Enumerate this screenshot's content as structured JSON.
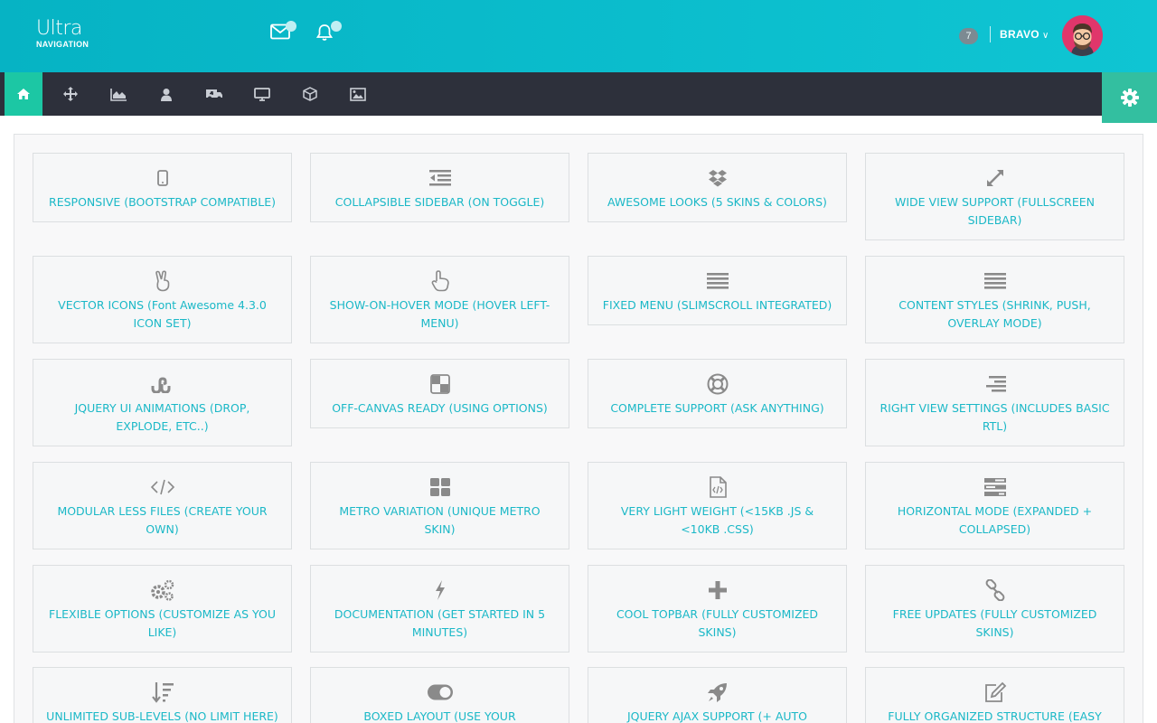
{
  "header": {
    "logo_title": "Ultra",
    "logo_subtitle": "NAVIGATION",
    "icons": [
      "envelope-icon",
      "bell-icon"
    ],
    "badge_count": "7",
    "username": "BRAVO",
    "username_chevron": "∨"
  },
  "nav": {
    "items": [
      "home-icon",
      "arrows-icon",
      "area-chart-icon",
      "user-icon",
      "ambulance-icon",
      "desktop-icon",
      "cube-icon",
      "image-icon"
    ],
    "active_index": 0,
    "settings_icon": "gear-icon"
  },
  "colors": {
    "header": "#0fbfcf",
    "navbar": "#2d303b",
    "active": "#1cc7a4",
    "card_text": "#1bb8c7",
    "icon": "#8a8a8a"
  },
  "features": [
    {
      "icon": "mobile-icon",
      "label": "RESPONSIVE (BOOTSTRAP COMPATIBLE)"
    },
    {
      "icon": "outdent-icon",
      "label": "COLLAPSIBLE SIDEBAR (ON TOGGLE)"
    },
    {
      "icon": "dropbox-icon",
      "label": "AWESOME LOOKS (5 SKINS & COLORS)"
    },
    {
      "icon": "expand-icon",
      "label": "WIDE VIEW SUPPORT (FULLSCREEN SIDEBAR)"
    },
    {
      "icon": "hand-peace-icon",
      "label": "VECTOR ICONS (Font Awesome 4.3.0 ICON SET)"
    },
    {
      "icon": "hand-pointer-icon",
      "label": "SHOW-ON-HOVER MODE (HOVER LEFT-MENU)"
    },
    {
      "icon": "bars-icon",
      "label": "FIXED MENU (SLIMSCROLL INTEGRATED)"
    },
    {
      "icon": "bars-icon",
      "label": "CONTENT STYLES (SHRINK, PUSH, OVERLAY MODE)"
    },
    {
      "icon": "stumbleupon-icon",
      "label": "JQUERY UI ANIMATIONS (DROP, EXPLODE, ETC..)"
    },
    {
      "icon": "delicious-icon",
      "label": "OFF-CANVAS READY (USING OPTIONS)"
    },
    {
      "icon": "life-ring-icon",
      "label": "COMPLETE SUPPORT (ASK ANYTHING)"
    },
    {
      "icon": "align-right-icon",
      "label": "RIGHT VIEW SETTINGS (INCLUDES BASIC RTL)"
    },
    {
      "icon": "code-icon",
      "label": "MODULAR LESS FILES (CREATE YOUR OWN)"
    },
    {
      "icon": "th-large-icon",
      "label": "METRO VARIATION (UNIQUE METRO SKIN)"
    },
    {
      "icon": "file-code-icon",
      "label": "VERY LIGHT WEIGHT (<15KB .JS & <10KB .CSS)"
    },
    {
      "icon": "tasks-icon",
      "label": "HORIZONTAL MODE (EXPANDED + COLLAPSED)"
    },
    {
      "icon": "cogs-icon",
      "label": "FLEXIBLE OPTIONS (CUSTOMIZE AS YOU LIKE)"
    },
    {
      "icon": "bolt-icon",
      "label": "DOCUMENTATION (GET STARTED IN 5 MINUTES)"
    },
    {
      "icon": "plus-icon",
      "label": "COOL TOPBAR (FULLY CUSTOMIZED SKINS)"
    },
    {
      "icon": "chain-icon",
      "label": "FREE UPDATES (FULLY CUSTOMIZED SKINS)"
    },
    {
      "icon": "sort-amount-desc-icon",
      "label": "UNLIMITED SUB-LEVELS (NO LIMIT HERE)"
    },
    {
      "icon": "toggle-on-icon",
      "label": "BOXED LAYOUT (USE YOUR"
    },
    {
      "icon": "rocket-icon",
      "label": "JQUERY AJAX SUPPORT (+ AUTO"
    },
    {
      "icon": "edit-icon",
      "label": "FULLY ORGANIZED STRUCTURE (EASY TO"
    }
  ]
}
